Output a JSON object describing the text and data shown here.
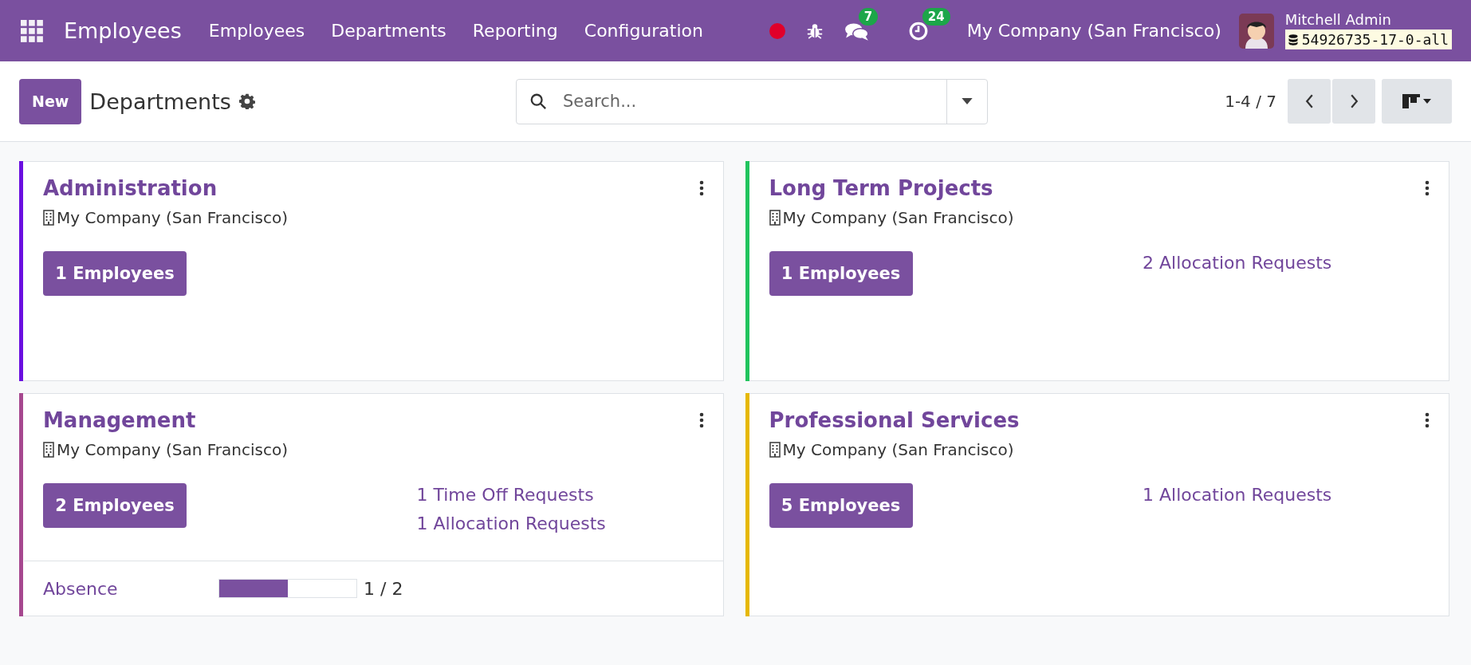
{
  "navbar": {
    "app_name": "Employees",
    "menu": [
      "Employees",
      "Departments",
      "Reporting",
      "Configuration"
    ],
    "messages_count": "7",
    "activities_count": "24",
    "company": "My Company (San Francisco)",
    "user_name": "Mitchell Admin",
    "database": "54926735-17-0-all"
  },
  "control_panel": {
    "new_button": "New",
    "breadcrumb": "Departments",
    "search": {
      "placeholder": "Search..."
    },
    "pager": "1-4 / 7"
  },
  "cards": [
    {
      "name": "Administration",
      "color": "#6a0fe0",
      "company": "My Company (San Francisco)",
      "employees_button": "1 Employees"
    },
    {
      "name": "Long Term Projects",
      "color": "#21c45d",
      "company": "My Company (San Francisco)",
      "employees_button": "1 Employees",
      "requests": [
        "2 Allocation Requests"
      ]
    },
    {
      "name": "Management",
      "color": "#a6488f",
      "company": "My Company (San Francisco)",
      "employees_button": "2 Employees",
      "requests": [
        "1 Time Off Requests",
        "1 Allocation Requests"
      ],
      "footer": {
        "label": "Absence",
        "level": 0.5,
        "reading": "1 / 2"
      }
    },
    {
      "name": "Professional Services",
      "color": "#e6b800",
      "company": "My Company (San Francisco)",
      "employees_button": "5 Employees",
      "requests": [
        "1 Allocation Requests"
      ]
    }
  ]
}
